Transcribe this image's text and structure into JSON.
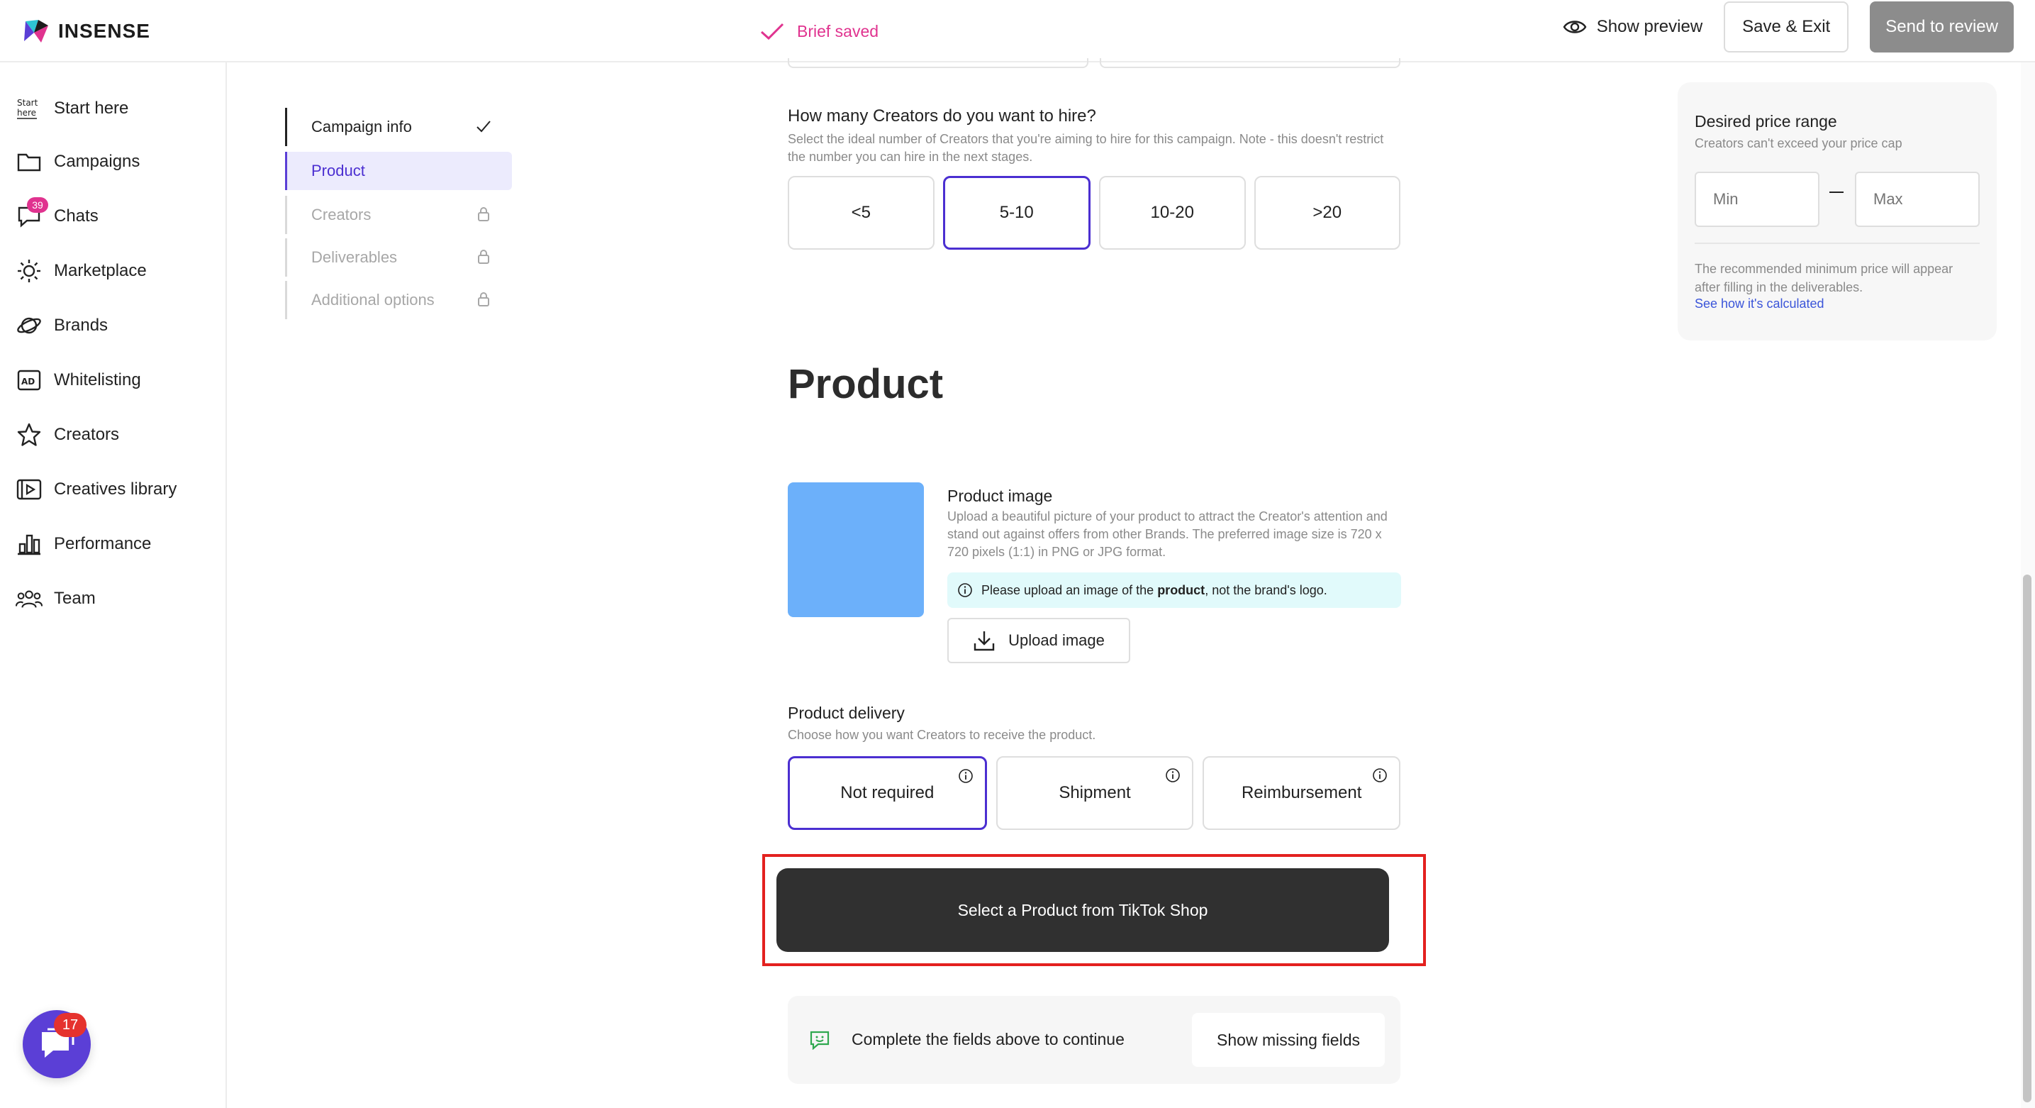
{
  "app": {
    "name": "INSENSE"
  },
  "header": {
    "status": "Brief saved",
    "show_preview": "Show preview",
    "save_exit": "Save & Exit",
    "send_review": "Send to review"
  },
  "sidebar": {
    "items": [
      {
        "label": "Start here",
        "icon": "start-here-icon"
      },
      {
        "label": "Campaigns",
        "icon": "folder-icon"
      },
      {
        "label": "Chats",
        "icon": "chat-icon",
        "badge": "39"
      },
      {
        "label": "Marketplace",
        "icon": "sun-icon"
      },
      {
        "label": "Brands",
        "icon": "planet-icon"
      },
      {
        "label": "Whitelisting",
        "icon": "ad-icon"
      },
      {
        "label": "Creators",
        "icon": "star-icon"
      },
      {
        "label": "Creatives library",
        "icon": "video-library-icon"
      },
      {
        "label": "Performance",
        "icon": "bar-chart-icon"
      },
      {
        "label": "Team",
        "icon": "team-icon"
      }
    ],
    "chat_fab_badge": "17"
  },
  "steps": [
    {
      "label": "Campaign info",
      "state": "done"
    },
    {
      "label": "Product",
      "state": "active"
    },
    {
      "label": "Creators",
      "state": "locked"
    },
    {
      "label": "Deliverables",
      "state": "locked"
    },
    {
      "label": "Additional options",
      "state": "locked"
    }
  ],
  "hire": {
    "question": "How many Creators do you want to hire?",
    "description": "Select the ideal number of Creators that you're aiming to hire for this campaign. Note - this doesn't restrict the number you can hire in the next stages.",
    "options": [
      "<5",
      "5-10",
      "10-20",
      ">20"
    ],
    "selected": "5-10"
  },
  "product": {
    "title": "Product",
    "image_label": "Product image",
    "image_description": "Upload a beautiful picture of your product to attract the Creator's attention and stand out against offers from other Brands. The preferred image size is 720 x 720 pixels (1:1) in PNG or JPG format.",
    "note_before": "Please upload an image of the ",
    "note_bold": "product",
    "note_after": ", not the brand's logo.",
    "upload_label": "Upload image",
    "image_color": "#6cb0fa"
  },
  "delivery": {
    "title": "Product delivery",
    "description": "Choose how you want Creators to receive the product.",
    "options": [
      "Not required",
      "Shipment",
      "Reimbursement"
    ],
    "selected": "Not required"
  },
  "tiktok_button": "Select a Product from TikTok Shop",
  "completion": {
    "text": "Complete the fields above to continue",
    "button": "Show missing fields"
  },
  "price": {
    "title": "Desired price range",
    "subtitle": "Creators can't exceed your price cap",
    "min_placeholder": "Min",
    "max_placeholder": "Max",
    "note": "The recommended minimum price will appear after filling in the deliverables.",
    "link": "See how it's calculated"
  },
  "colors": {
    "accent": "#4b2fd1",
    "brand_pink": "#e0338f",
    "highlight_red": "#e3211f",
    "dark_button": "#303030"
  }
}
